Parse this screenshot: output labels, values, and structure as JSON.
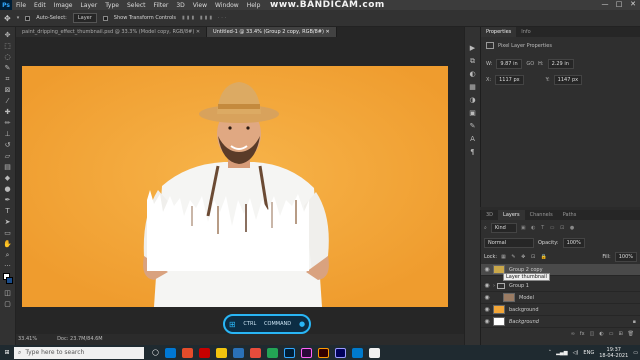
{
  "menubar": {
    "logo": "Ps",
    "items": [
      "File",
      "Edit",
      "Image",
      "Layer",
      "Type",
      "Select",
      "Filter",
      "3D",
      "View",
      "Window",
      "Help"
    ]
  },
  "watermark": "www.BANDICAM.com",
  "window_controls": [
    "—",
    "□",
    "✕"
  ],
  "options": {
    "auto_select_label": "Auto-Select:",
    "auto_select_value": "Layer",
    "transform_label": "Show Transform Controls"
  },
  "tabs": [
    {
      "label": "paint_dripping_effect_thumbnail.psd @ 33.3% (Model copy, RGB/8#) ✕",
      "active": false
    },
    {
      "label": "Untitled-1 @ 33.4% (Group 2 copy, RGB/8#) ✕",
      "active": true
    }
  ],
  "status": {
    "zoom": "33.41%",
    "doc": "Doc: 23.7M/84.6M"
  },
  "properties": {
    "tabs": [
      "Properties",
      "Info"
    ],
    "title": "Pixel Layer Properties",
    "w_label": "W:",
    "w_value": "9.87 in",
    "h_label": "H:",
    "h_value": "2.29 in",
    "link": "GO",
    "x_label": "X:",
    "x_value": "1117 px",
    "y_label": "Y:",
    "y_value": "1147 px"
  },
  "layers_panel": {
    "tabs": [
      "3D",
      "Layers",
      "Channels",
      "Paths"
    ],
    "kind": "Kind",
    "blend_mode": "Normal",
    "opacity_label": "Opacity:",
    "opacity_value": "100%",
    "lock_label": "Lock:",
    "fill_label": "Fill:",
    "fill_value": "100%",
    "tooltip": "Layer thumbnail",
    "layers": [
      {
        "name": "Group 2 copy",
        "selected": true,
        "thumb_color": "#caa84a"
      },
      {
        "name": "Group 1",
        "selected": false,
        "thumb_color": "#444444"
      },
      {
        "name": "Model",
        "selected": false,
        "thumb_color": "#9a7b63"
      },
      {
        "name": "background",
        "selected": false,
        "thumb_color": "#f2a638"
      },
      {
        "name": "Background",
        "selected": false,
        "thumb_color": "#ffffff"
      }
    ]
  },
  "keycast": {
    "ctrl": "CTRL",
    "command": "COMMAND"
  },
  "taskbar": {
    "search_placeholder": "Type here to search",
    "apps": [
      "#0078d4",
      "#e44c2b",
      "#c70000",
      "#f1c40f",
      "#2a71b8",
      "#e74c3c",
      "#23a455",
      "#31a8ff",
      "#ff61f6",
      "#ff9a00",
      "#9999ff",
      "#007acc",
      "#f0f0f0"
    ],
    "language": "ENG",
    "time": "19:37",
    "date": "18-04-2021"
  },
  "colors": {
    "accent": "#31a8ff",
    "photo_bg": "#f2a638"
  }
}
